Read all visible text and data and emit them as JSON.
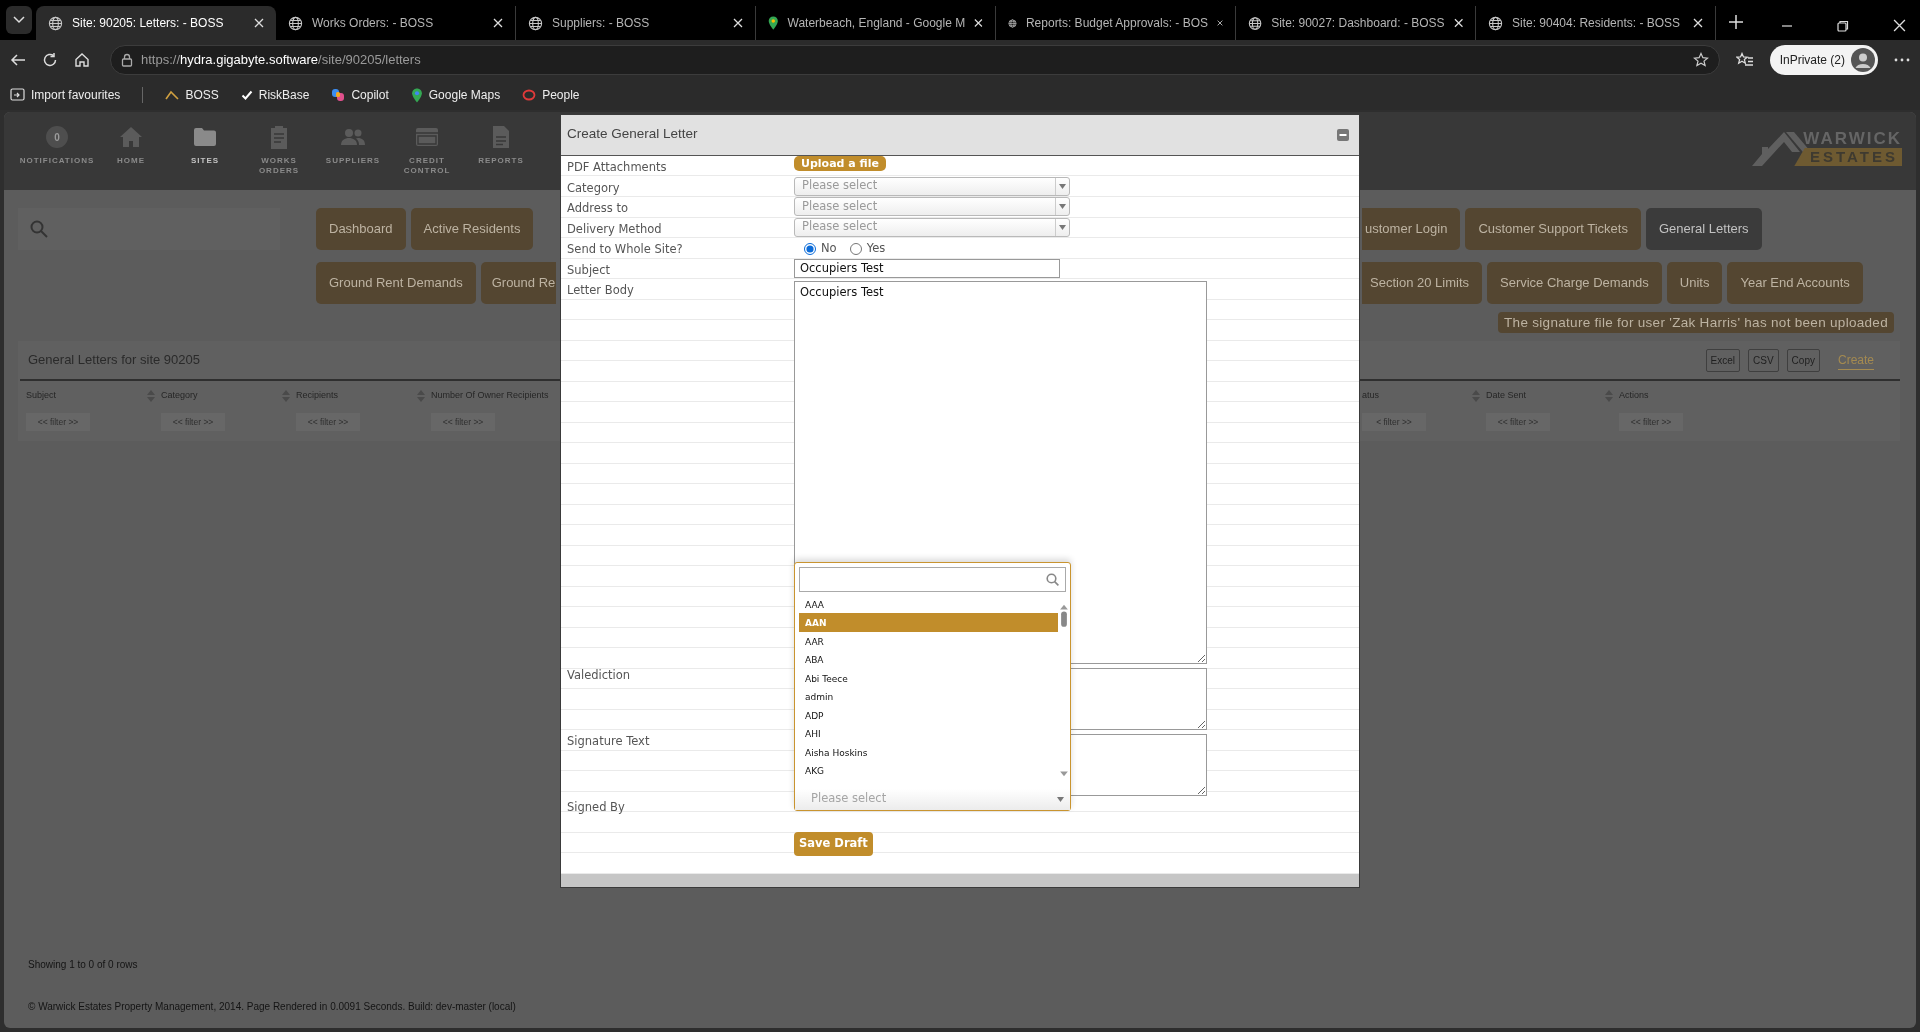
{
  "browser": {
    "tabs": [
      {
        "title": "Site: 90205: Letters: - BOSS",
        "selected": true
      },
      {
        "title": "Works Orders: - BOSS",
        "selected": false
      },
      {
        "title": "Suppliers: - BOSS",
        "selected": false
      },
      {
        "title": "Waterbeach, England - Google M",
        "selected": false
      },
      {
        "title": "Reports: Budget Approvals: - BOS",
        "selected": false
      },
      {
        "title": "Site: 90027: Dashboard: - BOSS",
        "selected": false
      },
      {
        "title": "Site: 90404: Residents: - BOSS",
        "selected": false
      }
    ],
    "address": {
      "scheme": "https://",
      "host": "hydra.gigabyte.software",
      "path": "/site/90205/letters"
    },
    "profile": "InPrivate (2)",
    "bookmarks": [
      "Import favourites",
      "BOSS",
      "RiskBase",
      "Copilot",
      "Google Maps",
      "People"
    ]
  },
  "app": {
    "nav": [
      {
        "label": "NOTIFICATIONS",
        "badge": "0",
        "selected": false
      },
      {
        "label": "HOME",
        "selected": false
      },
      {
        "label": "SITES",
        "selected": true
      },
      {
        "label": "WORKS ORDERS",
        "selected": false
      },
      {
        "label": "SUPPLIERS",
        "selected": false
      },
      {
        "label": "CREDIT CONTROL",
        "selected": false
      },
      {
        "label": "REPORTS",
        "selected": false
      }
    ],
    "logo": {
      "name": "WARWICK",
      "tagline": "ESTATES"
    },
    "button_rows": [
      {
        "left": [
          {
            "label": "Dashboard",
            "selected": false
          },
          {
            "label": "Active Residents",
            "selected": false
          }
        ],
        "right": [
          {
            "label": "ustomer Login",
            "selected": false
          },
          {
            "label": "Customer Support Tickets",
            "selected": false
          },
          {
            "label": "General Letters",
            "selected": true
          }
        ]
      },
      {
        "left": [
          {
            "label": "Ground Rent Demands",
            "selected": false
          },
          {
            "label": "Ground Re",
            "selected": false
          }
        ],
        "right": [
          {
            "label": "Section 20 Limits",
            "selected": false
          },
          {
            "label": "Service Charge Demands",
            "selected": false
          },
          {
            "label": "Units",
            "selected": false
          },
          {
            "label": "Year End Accounts",
            "selected": false
          }
        ]
      }
    ],
    "warning": "The signature file for user 'Zak Harris' has not been uploaded",
    "table": {
      "title": "General Letters for site 90205",
      "exports": [
        "Excel",
        "CSV",
        "Copy"
      ],
      "create": "Create",
      "columns_left": [
        {
          "label": "Subject",
          "sortable": true,
          "filter": "<< filter >>"
        },
        {
          "label": "Category",
          "sortable": true,
          "filter": "<< filter >>"
        },
        {
          "label": "Recipients",
          "sortable": true,
          "filter": "<< filter >>"
        },
        {
          "label": "Number Of Owner Recipients",
          "sortable": false,
          "filter": "<< filter >>"
        }
      ],
      "columns_right": [
        {
          "label": "atus",
          "sortable": true,
          "filter": "< filter >>"
        },
        {
          "label": "Date Sent",
          "sortable": true,
          "filter": "<< filter >>"
        },
        {
          "label": "Actions",
          "sortable": false,
          "filter": "<< filter >>"
        }
      ]
    },
    "footer": {
      "info": "Showing 1 to 0 of 0 rows",
      "copyright": "© Warwick Estates Property Management, 2014. Page Rendered in 0.0091 Seconds. Build: dev-master (local)"
    }
  },
  "modal": {
    "title": "Create General Letter",
    "fields": [
      {
        "kind": "upload",
        "label": "PDF Attachments",
        "button": "Upload a file"
      },
      {
        "kind": "select",
        "label": "Category",
        "placeholder": "Please select"
      },
      {
        "kind": "select",
        "label": "Address to",
        "placeholder": "Please select"
      },
      {
        "kind": "select",
        "label": "Delivery Method",
        "placeholder": "Please select"
      },
      {
        "kind": "radio",
        "label": "Send to Whole Site?",
        "options": [
          {
            "label": "No",
            "selected": true
          },
          {
            "label": "Yes",
            "selected": false
          }
        ]
      },
      {
        "kind": "text",
        "label": "Subject",
        "value": "Occupiers Test"
      },
      {
        "kind": "long_text",
        "label": "Letter Body",
        "value": "Occupiers Test"
      },
      {
        "kind": "short_text",
        "label": "Valediction"
      },
      {
        "kind": "short_text",
        "label": "Signature Text"
      },
      {
        "kind": "open_select",
        "label": "Signed By",
        "placeholder": "Please select",
        "options": [
          {
            "label": "AAA",
            "selected": false
          },
          {
            "label": "AAN",
            "selected": true
          },
          {
            "label": "AAR",
            "selected": false
          },
          {
            "label": "ABA",
            "selected": false
          },
          {
            "label": "Abi Teece",
            "selected": false
          },
          {
            "label": "admin",
            "selected": false
          },
          {
            "label": "ADP",
            "selected": false
          },
          {
            "label": "AHI",
            "selected": false
          },
          {
            "label": "Aisha Hoskins",
            "selected": false
          },
          {
            "label": "AKG",
            "selected": false
          }
        ]
      }
    ],
    "save": "Save Draft"
  }
}
